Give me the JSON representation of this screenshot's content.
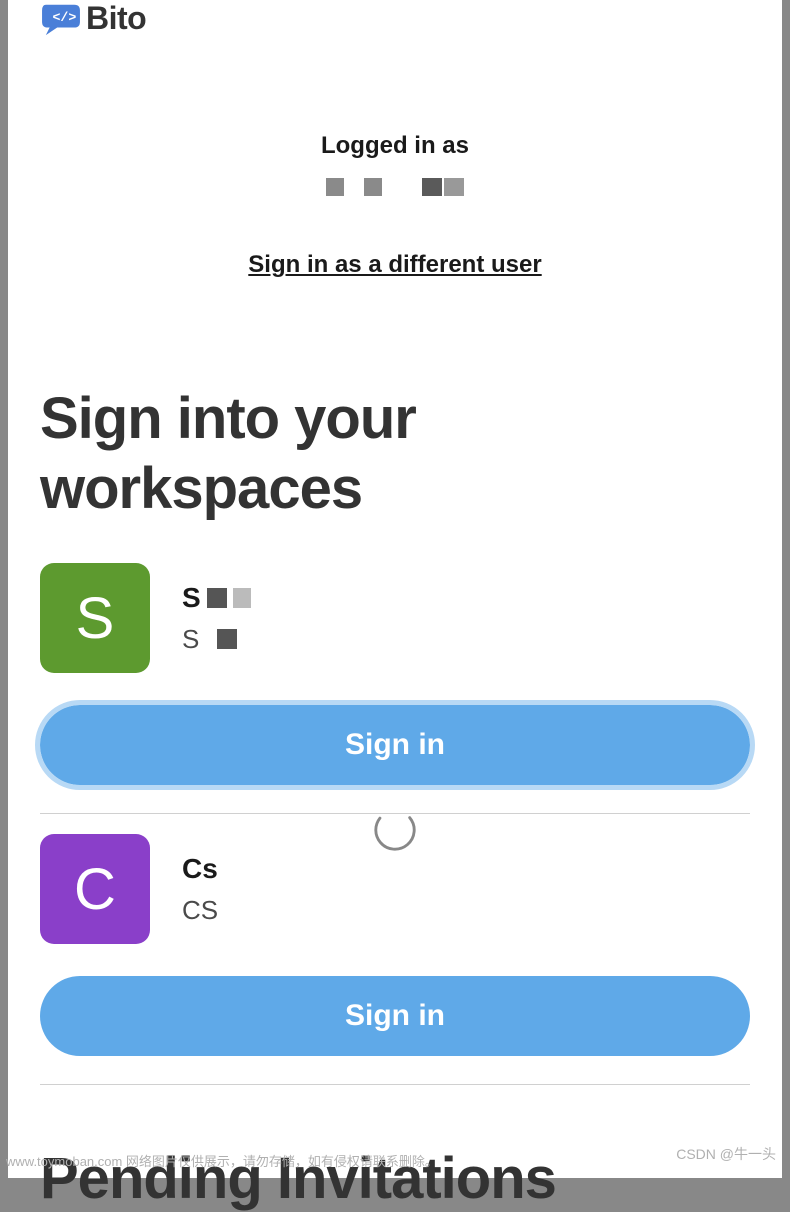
{
  "logo": {
    "text": "Bito"
  },
  "logged_in": {
    "label": "Logged in as",
    "sign_in_different": "Sign in as a different user"
  },
  "heading": "Sign into your workspaces",
  "workspaces": [
    {
      "avatar_letter": "S",
      "avatar_color": "green",
      "name": "S",
      "sub": "S",
      "button_label": "Sign in",
      "focused": true
    },
    {
      "avatar_letter": "C",
      "avatar_color": "purple",
      "name": "Cs",
      "sub": "CS",
      "button_label": "Sign in",
      "focused": false
    }
  ],
  "pending_heading": "Pending Invitations",
  "watermarks": {
    "left": "www.toymoban.com 网络图片仅供展示，请勿存储，如有侵权请联系删除。",
    "right": "CSDN @牛一头"
  }
}
